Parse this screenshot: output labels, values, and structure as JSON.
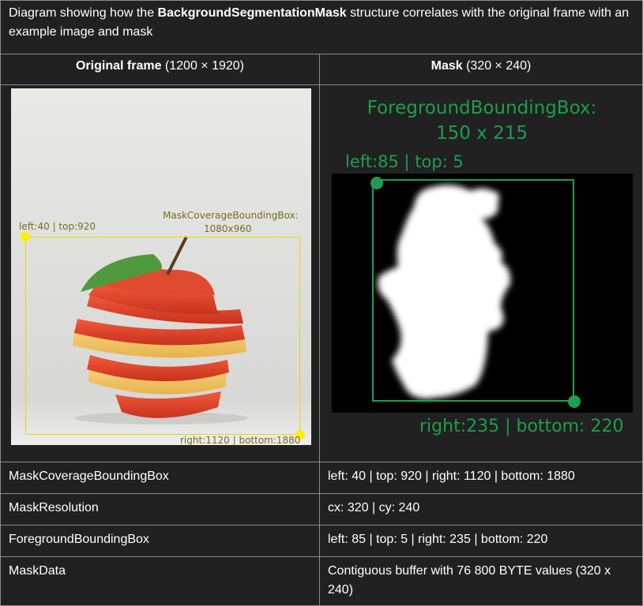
{
  "caption": {
    "prefix": "Diagram showing how the ",
    "bold": "BackgroundSegmentationMask",
    "suffix": " structure correlates with the original frame with an example image and mask"
  },
  "headers": {
    "left_bold": "Original frame",
    "left_dims": " (1200 × 1920)",
    "right_bold": "Mask",
    "right_dims": " (320 × 240)"
  },
  "left_panel": {
    "top_left_label": "left:40 | top:920",
    "box_label_line1": "MaskCoverageBoundingBox:",
    "box_label_line2": "1080x960",
    "bottom_right_label": "right:1120 | bottom:1880"
  },
  "right_panel": {
    "title_line1": "ForegroundBoundingBox:",
    "title_line2": "150 x 215",
    "top_left_label": "left:85 | top: 5",
    "bottom_right_label": "right:235 | bottom: 220"
  },
  "rows": [
    {
      "label": "MaskCoverageBoundingBox",
      "value": "left: 40 | top: 920 | right: 1120 | bottom: 1880"
    },
    {
      "label": "MaskResolution",
      "value": "cx: 320 | cy: 240"
    },
    {
      "label": "ForegroundBoundingBox",
      "value": "left: 85 | top: 5 | right: 235 | bottom: 220"
    },
    {
      "label": "MaskData",
      "value": "Contiguous buffer with 76 800 BYTE values (320 x 240)"
    }
  ],
  "colors": {
    "yellow_box": "#e6d800",
    "green_box": "#1e9e4e",
    "apple": "#e8442c",
    "leaf": "#4f9a3c"
  }
}
